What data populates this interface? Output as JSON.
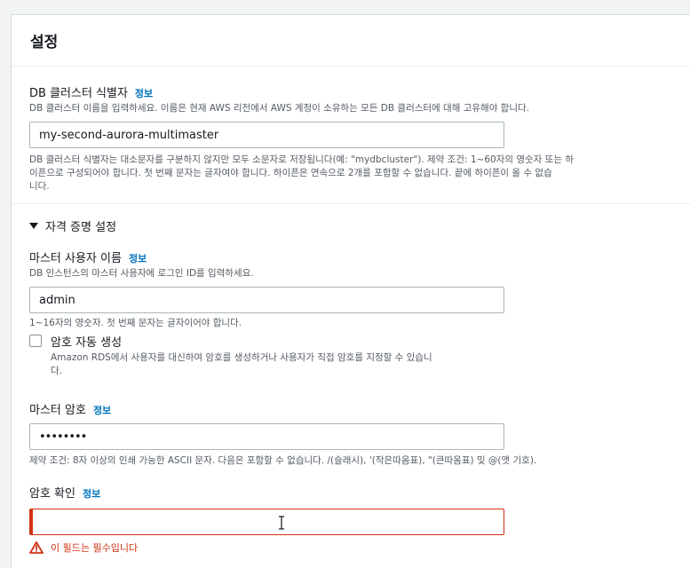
{
  "settings": {
    "title": "설정",
    "cluster_id": {
      "label": "DB 클러스터 식별자",
      "info": "정보",
      "description": "DB 클러스터 이름을 입력하세요. 이름은 현재 AWS 리전에서 AWS 계정이 소유하는 모든 DB 클러스터에 대해 고유해야 합니다.",
      "value": "my-second-aurora-multimaster",
      "constraint_line1": "DB 클러스터 식별자는 대소문자를 구분하지 않지만 모두 소문자로 저장됩니다(예: \"mydbcluster\"). 제약 조건: 1~60자의 영숫자 또는 하",
      "constraint_line2": "이픈으로 구성되어야 합니다. 첫 번째 문자는 글자여야 합니다. 하이픈은 연속으로 2개를 포함할 수 없습니다. 끝에 하이픈이 올 수 없습",
      "constraint_line3": "니다."
    },
    "credentials": {
      "title": "자격 증명 설정",
      "master_username": {
        "label": "마스터 사용자 이름",
        "info": "정보",
        "description": "DB 인스턴스의 마스터 사용자에 로그인 ID를 입력하세요.",
        "value": "admin",
        "constraint": "1~16자의 영숫자. 첫 번째 문자는 글자이어야 합니다."
      },
      "auto_password": {
        "label": "암호 자동 생성",
        "description_line1": "Amazon RDS에서 사용자를 대신하여 암호를 생성하거나 사용자가 직접 암호를 지정할 수 있습니",
        "description_line2": "다."
      },
      "master_password": {
        "label": "마스터 암호",
        "info": "정보",
        "value": "••••••••",
        "constraint": "제약 조건: 8자 이상의 인쇄 가능한 ASCII 문자. 다음은 포함할 수 없습니다. /(슬래시), '(작은따옴표), \"(큰따옴표) 및 @(앳 기호)."
      },
      "confirm_password": {
        "label": "암호 확인",
        "info": "정보",
        "value": "",
        "error": "이 필드는 필수입니다"
      }
    }
  },
  "colors": {
    "link": "#0073bb",
    "error": "#d13212",
    "text": "#16191f",
    "muted": "#545b64"
  }
}
